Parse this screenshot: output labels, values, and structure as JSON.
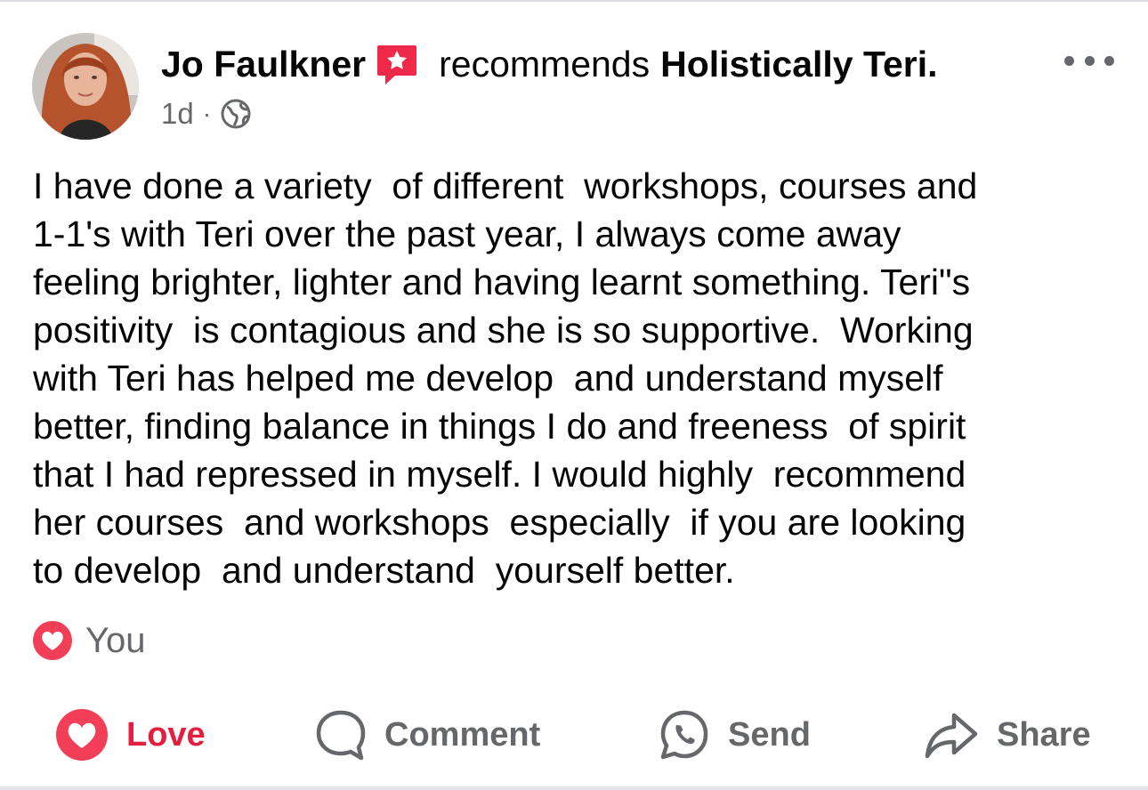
{
  "post": {
    "author": "Jo Faulkner",
    "verb": "recommends",
    "page_name": "Holistically Teri.",
    "time": "1d",
    "separator": "·",
    "privacy_icon": "globe-icon",
    "text_lines": [
      "I have done a variety  of different  workshops, courses and",
      "1-1's with Teri over the past year, I always come away",
      "feeling brighter, lighter and having learnt something. Teri\"s",
      "positivity  is contagious and she is so supportive.  Working",
      "with Teri has helped me develop  and understand myself",
      "better, finding balance in things I do and freeness  of spirit",
      "that I had repressed in myself. I would highly  recommend",
      "her courses  and workshops  especially  if you are looking",
      "to develop  and understand  yourself better."
    ]
  },
  "reactions": {
    "icon": "heart-icon",
    "label": "You"
  },
  "actions": {
    "love": "Love",
    "comment": "Comment",
    "send": "Send",
    "share": "Share"
  },
  "colors": {
    "love_red": "#e41e3f",
    "recommend_badge": "#f02849",
    "secondary_text": "#65676b"
  }
}
